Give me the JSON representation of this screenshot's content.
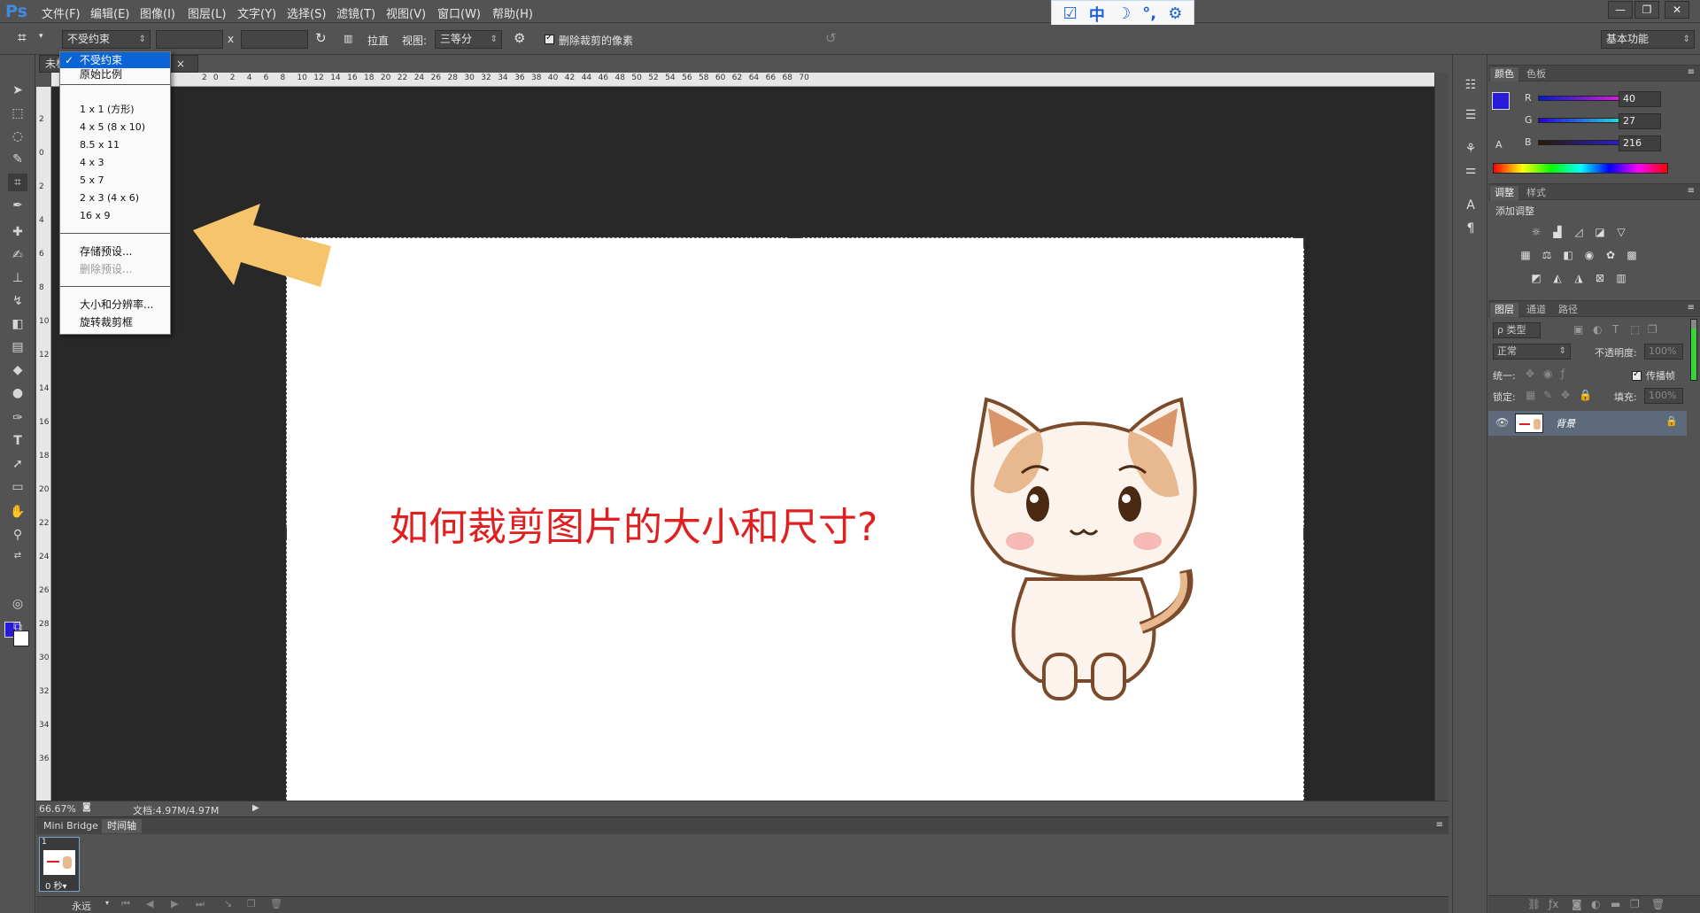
{
  "app": {
    "logo": "Ps"
  },
  "menu": [
    "文件(F)",
    "编辑(E)",
    "图像(I)",
    "图层(L)",
    "文字(Y)",
    "选择(S)",
    "滤镜(T)",
    "视图(V)",
    "窗口(W)",
    "帮助(H)"
  ],
  "window_controls": [
    "—",
    "❐",
    "✕"
  ],
  "ime_icons": [
    "☑",
    "中",
    "☽",
    "°,",
    "⚙"
  ],
  "options": {
    "ratio_value": "不受约束",
    "x_sep": "x",
    "straighten_label": "拉直",
    "view_label": "视图:",
    "view_value": "三等分",
    "delete_pixels_label": "删除裁剪的像素",
    "workspace_value": "基本功能"
  },
  "document": {
    "tab_label": "未标",
    "close_glyph": "×"
  },
  "ruler_top_labels": [
    "2",
    "0",
    "2",
    "4",
    "6",
    "8",
    "10",
    "12",
    "14",
    "16",
    "18",
    "20",
    "22",
    "24",
    "26",
    "28",
    "30",
    "32",
    "34",
    "36",
    "38",
    "40",
    "42",
    "44",
    "46",
    "48",
    "50",
    "52",
    "54",
    "56",
    "58",
    "60",
    "62",
    "64",
    "66",
    "68",
    "70"
  ],
  "ruler_left_labels": [
    "2",
    "0",
    "2",
    "4",
    "6",
    "8",
    "10",
    "12",
    "14",
    "16",
    "18",
    "20",
    "22",
    "24",
    "26",
    "28",
    "30",
    "32",
    "34",
    "36"
  ],
  "canvas": {
    "headline": "如何裁剪图片的大小和尺寸?"
  },
  "preset_menu": {
    "items": [
      {
        "label": "不受约束",
        "state": "selected"
      },
      {
        "label": "原始比例",
        "state": "normal"
      },
      {
        "label": "1 x 1 (方形)",
        "state": "small"
      },
      {
        "label": "4 x 5 (8 x 10)",
        "state": "small"
      },
      {
        "label": "8.5 x 11",
        "state": "small"
      },
      {
        "label": "4 x 3",
        "state": "small"
      },
      {
        "label": "5 x 7",
        "state": "small"
      },
      {
        "label": "2 x 3 (4 x 6)",
        "state": "small"
      },
      {
        "label": "16 x 9",
        "state": "small"
      },
      {
        "label": "存储预设...",
        "state": "normal"
      },
      {
        "label": "删除预设...",
        "state": "disabled"
      },
      {
        "label": "大小和分辨率...",
        "state": "normal"
      },
      {
        "label": "旋转裁剪框",
        "state": "normal"
      }
    ],
    "check_glyph": "✓"
  },
  "status": {
    "zoom": "66.67%",
    "doc_info": "文档:4.97M/4.97M"
  },
  "timeline": {
    "tabs": [
      "Mini Bridge",
      "时间轴"
    ],
    "frame_number": "1",
    "frame_delay": "0 秒▾",
    "loop_value": "永远"
  },
  "color_panel": {
    "tabs": [
      "颜色",
      "色板"
    ],
    "channels": [
      {
        "name": "R",
        "value": "40"
      },
      {
        "name": "G",
        "value": "27"
      },
      {
        "name": "B",
        "value": "216"
      }
    ],
    "foreground": "#281bd8"
  },
  "adjust_panel": {
    "tabs": [
      "调整",
      "样式"
    ],
    "title": "添加调整"
  },
  "layers_panel": {
    "tabs": [
      "图层",
      "通道",
      "路径"
    ],
    "filter_kind": "ρ 类型",
    "blend_mode": "正常",
    "opacity_label": "不透明度:",
    "opacity_value": "100%",
    "unify_label": "统一:",
    "propagate_label": "传播帧",
    "lock_label": "锁定:",
    "fill_label": "填充:",
    "fill_value": "100%",
    "layer_name": "背景"
  },
  "colors": {
    "accent": "#0a64d8",
    "headline": "#e02020",
    "arrow": "#f6c56b",
    "ps_blue": "#3f8be0"
  }
}
